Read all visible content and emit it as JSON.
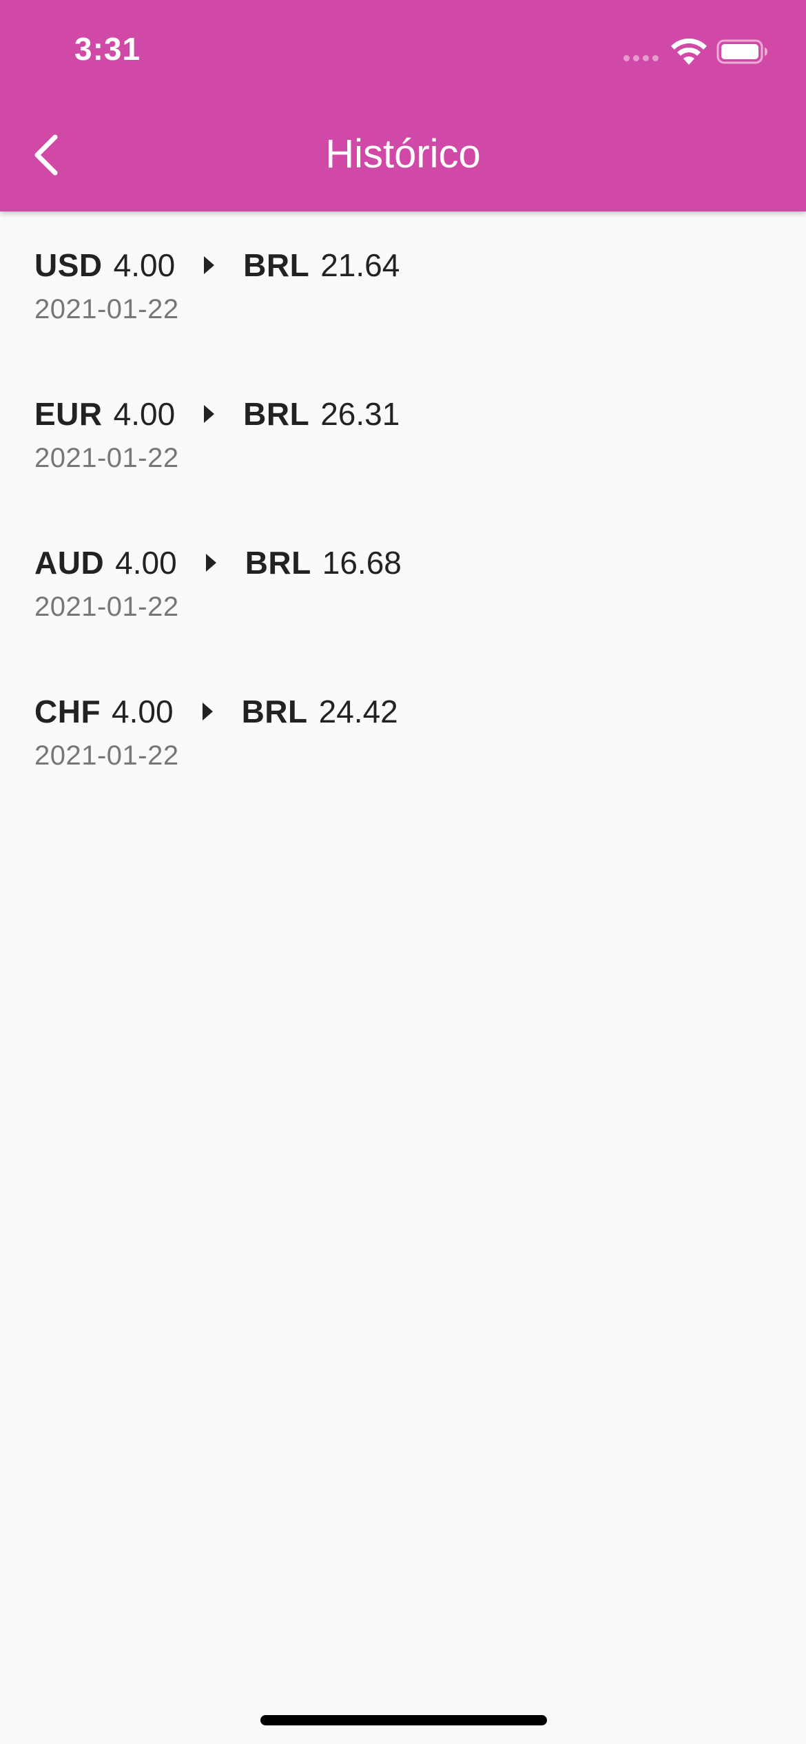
{
  "status_bar": {
    "time": "3:31"
  },
  "header": {
    "title": "Histórico",
    "back_icon": "chevron-left-icon",
    "background": "#d149a6"
  },
  "history": [
    {
      "from_code": "USD",
      "from_amount": "4.00",
      "to_code": "BRL",
      "to_amount": "21.64",
      "date": "2021-01-22"
    },
    {
      "from_code": "EUR",
      "from_amount": "4.00",
      "to_code": "BRL",
      "to_amount": "26.31",
      "date": "2021-01-22"
    },
    {
      "from_code": "AUD",
      "from_amount": "4.00",
      "to_code": "BRL",
      "to_amount": "16.68",
      "date": "2021-01-22"
    },
    {
      "from_code": "CHF",
      "from_amount": "4.00",
      "to_code": "BRL",
      "to_amount": "24.42",
      "date": "2021-01-22"
    }
  ]
}
